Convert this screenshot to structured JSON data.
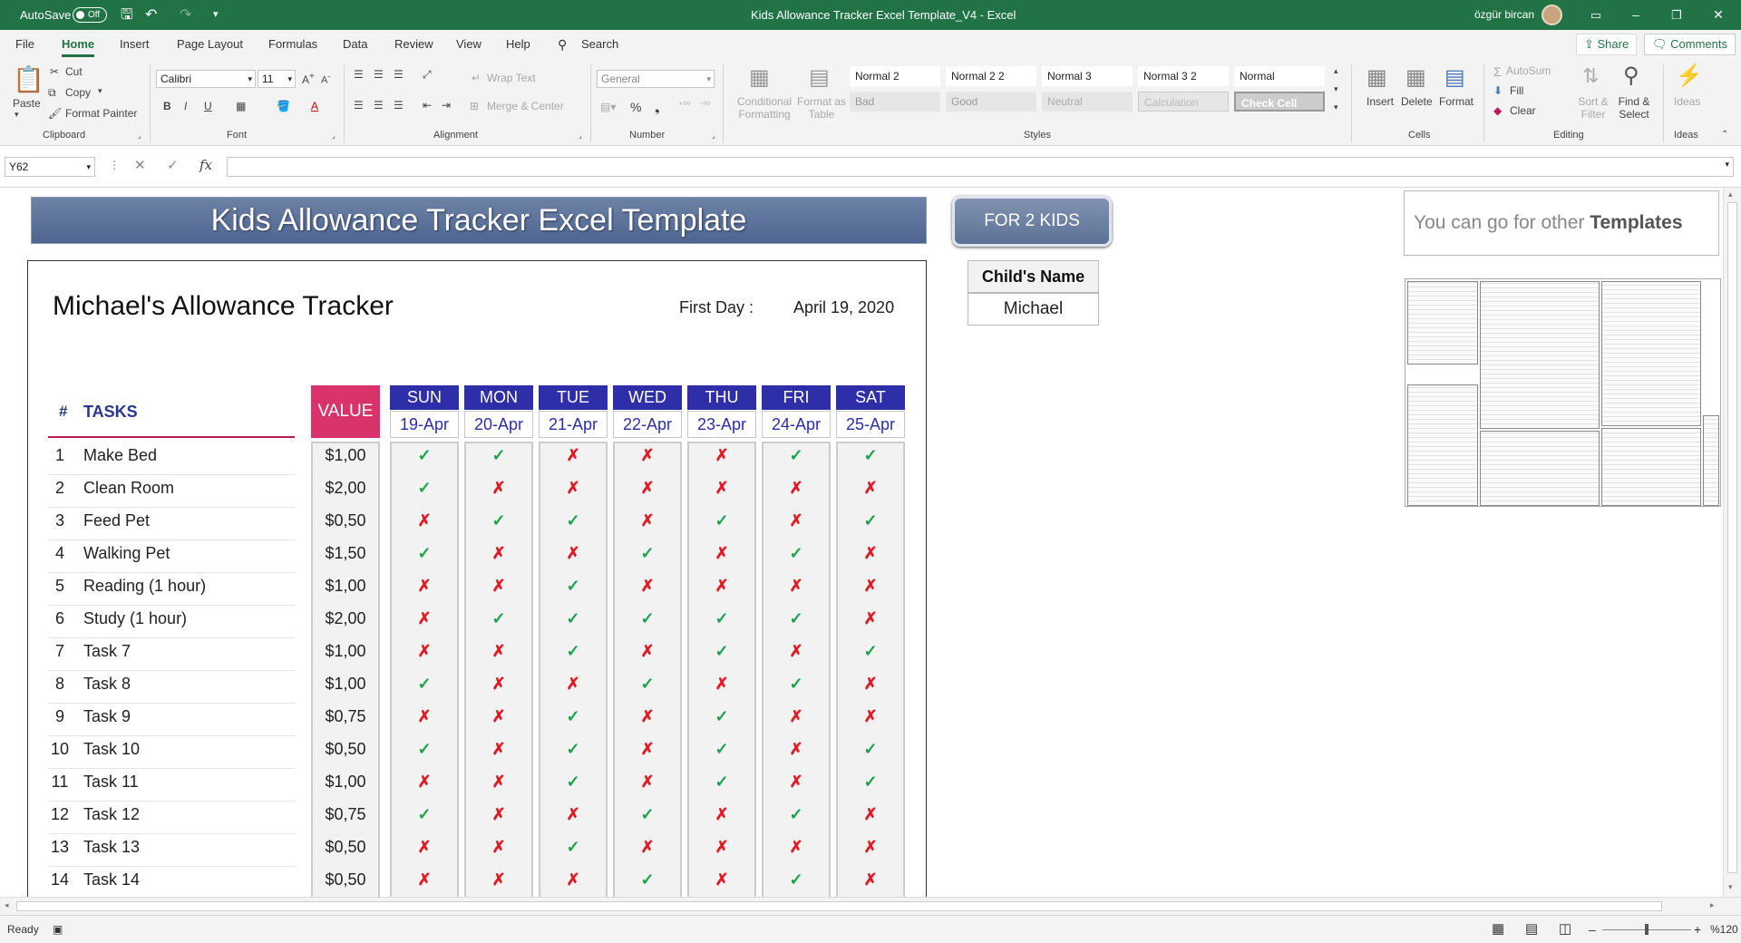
{
  "titlebar": {
    "autosave_label": "AutoSave",
    "autosave_state": "Off",
    "doc_title": "Kids Allowance Tracker Excel Template_V4  -  Excel",
    "user_name": "özgür bircan"
  },
  "menu": {
    "file": "File",
    "home": "Home",
    "insert": "Insert",
    "page_layout": "Page Layout",
    "formulas": "Formulas",
    "data": "Data",
    "review": "Review",
    "view": "View",
    "help": "Help",
    "search": "Search",
    "share": "Share",
    "comments": "Comments"
  },
  "ribbon": {
    "clipboard": {
      "paste": "Paste",
      "cut": "Cut",
      "copy": "Copy",
      "format_painter": "Format Painter",
      "label": "Clipboard"
    },
    "font": {
      "name": "Calibri",
      "size": "11",
      "label": "Font"
    },
    "alignment": {
      "wrap_text": "Wrap Text",
      "merge_center": "Merge & Center",
      "label": "Alignment"
    },
    "number": {
      "format": "General",
      "label": "Number"
    },
    "styles": {
      "conditional_formatting": "Conditional Formatting",
      "format_as_table": "Format as Table",
      "cells": [
        "Normal 2",
        "Normal 2 2",
        "Normal 3",
        "Normal 3 2",
        "Normal",
        "Bad",
        "Good",
        "Neutral",
        "Calculation",
        "Check Cell"
      ],
      "label": "Styles"
    },
    "cells": {
      "insert": "Insert",
      "delete": "Delete",
      "format": "Format",
      "label": "Cells"
    },
    "editing": {
      "autosum": "AutoSum",
      "fill": "Fill",
      "clear": "Clear",
      "sort_filter": "Sort & Filter",
      "find_select": "Find & Select",
      "label": "Editing"
    },
    "ideas": {
      "ideas": "Ideas",
      "label": "Ideas"
    }
  },
  "formula_bar": {
    "name_box": "Y62",
    "fx": "fx",
    "value": ""
  },
  "sheet": {
    "banner": "Kids Allowance Tracker Excel Template",
    "for_kids_button": "FOR 2 KIDS",
    "promo_text": "You can go for other",
    "promo_bold": "Templates",
    "tracker_title": "Michael's Allowance Tracker",
    "first_day_label": "First Day :",
    "first_day_value": "April 19, 2020",
    "hash_header": "#",
    "tasks_header": "TASKS",
    "value_header": "VALUE",
    "child_name_label": "Child's Name",
    "child_name": "Michael",
    "days": [
      {
        "name": "SUN",
        "date": "19-Apr"
      },
      {
        "name": "MON",
        "date": "20-Apr"
      },
      {
        "name": "TUE",
        "date": "21-Apr"
      },
      {
        "name": "WED",
        "date": "22-Apr"
      },
      {
        "name": "THU",
        "date": "23-Apr"
      },
      {
        "name": "FRI",
        "date": "24-Apr"
      },
      {
        "name": "SAT",
        "date": "25-Apr"
      }
    ],
    "tasks": [
      {
        "n": "1",
        "name": "Make Bed",
        "value": "$1,00",
        "marks": "YYNNNYY"
      },
      {
        "n": "2",
        "name": "Clean Room",
        "value": "$2,00",
        "marks": "YNNNNNN"
      },
      {
        "n": "3",
        "name": "Feed Pet",
        "value": "$0,50",
        "marks": "NYYNYNY"
      },
      {
        "n": "4",
        "name": "Walking Pet",
        "value": "$1,50",
        "marks": "YNNYNYN"
      },
      {
        "n": "5",
        "name": "Reading (1 hour)",
        "value": "$1,00",
        "marks": "NNYNNNN"
      },
      {
        "n": "6",
        "name": "Study (1 hour)",
        "value": "$2,00",
        "marks": "NYYYYYN"
      },
      {
        "n": "7",
        "name": "Task 7",
        "value": "$1,00",
        "marks": "NNYNYNY"
      },
      {
        "n": "8",
        "name": "Task 8",
        "value": "$1,00",
        "marks": "YNNYNYN"
      },
      {
        "n": "9",
        "name": "Task 9",
        "value": "$0,75",
        "marks": "NNYNYNN"
      },
      {
        "n": "10",
        "name": "Task 10",
        "value": "$0,50",
        "marks": "YNYNYNY"
      },
      {
        "n": "11",
        "name": "Task 11",
        "value": "$1,00",
        "marks": "NNYNYNY"
      },
      {
        "n": "12",
        "name": "Task 12",
        "value": "$0,75",
        "marks": "YNNYNYN"
      },
      {
        "n": "13",
        "name": "Task 13",
        "value": "$0,50",
        "marks": "NNYNNNN"
      },
      {
        "n": "14",
        "name": "Task 14",
        "value": "$0,50",
        "marks": "NNNYNYN"
      }
    ],
    "mark_yes": "✓",
    "mark_no": "✗"
  },
  "status": {
    "ready": "Ready",
    "zoom": "%120"
  },
  "colors": {
    "excel_green": "#217346",
    "day_header": "#2d2ea8",
    "value_header": "#d8336b",
    "check": "#1aa34a",
    "cross": "#e01b24"
  }
}
